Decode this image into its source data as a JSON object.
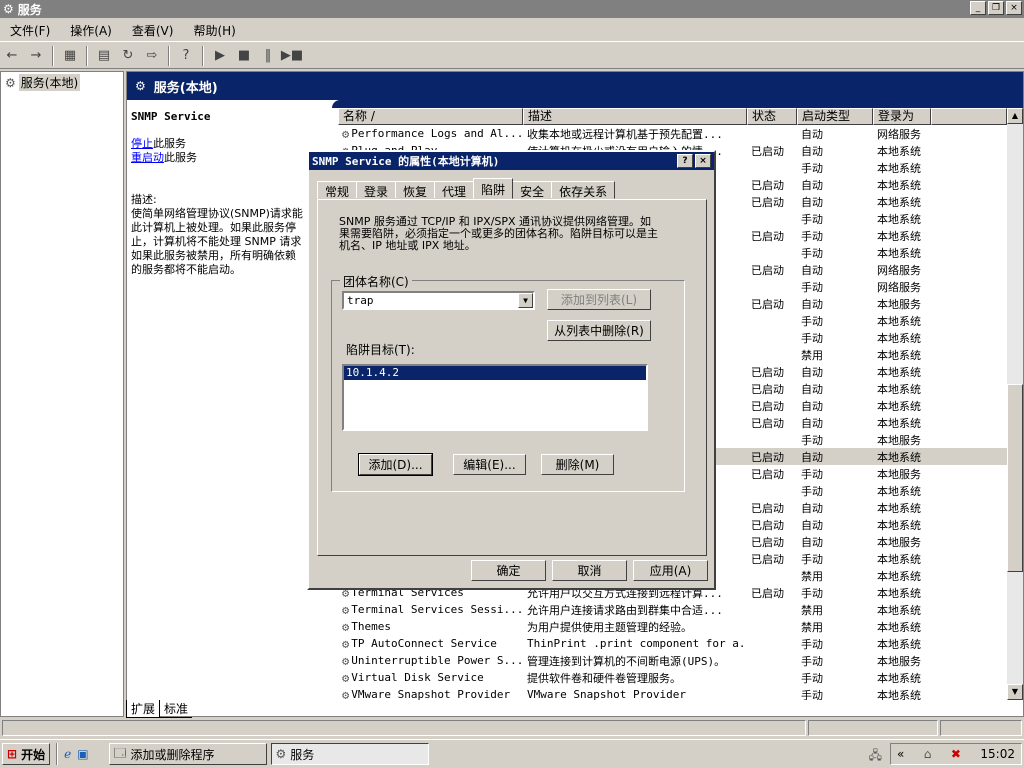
{
  "window": {
    "title": "服务",
    "min": "_",
    "restore": "❐",
    "close": "×"
  },
  "menu": [
    "文件(F)",
    "操作(A)",
    "查看(V)",
    "帮助(H)"
  ],
  "toolbar": [
    "←",
    "→",
    "▦",
    "▤",
    "↻",
    "⇨",
    "?",
    "▶",
    "■",
    "‖",
    "▶■"
  ],
  "tree": {
    "root": "服务(本地)"
  },
  "pane_header": "服务(本地)",
  "desc": {
    "name": "SNMP Service",
    "stop_link": "停止",
    "stop_suffix": "此服务",
    "restart_link": "重启动",
    "restart_suffix": "此服务",
    "label": "描述:",
    "lines": [
      "使简单网络管理协议(SNMP)请求能",
      "此计算机上被处理。如果此服务停",
      "止，计算机将不能处理 SNMP 请求",
      "如果此服务被禁用，所有明确依赖",
      "的服务都将不能启动。"
    ]
  },
  "list": {
    "headers": [
      "名称 /",
      "描述",
      "状态",
      "启动类型",
      "登录为"
    ],
    "rows": [
      [
        "Performance Logs and Al...",
        "收集本地或远程计算机基于预先配置...",
        "",
        "自动",
        "网络服务"
      ],
      [
        "Plug and Play",
        "使计算机在极少或没有用户输入的情...",
        "已启动",
        "自动",
        "本地系统"
      ],
      [
        "",
        "",
        "",
        "手动",
        "本地系统"
      ],
      [
        "",
        "",
        "已启动",
        "自动",
        "本地系统"
      ],
      [
        "",
        "",
        "已启动",
        "自动",
        "本地系统"
      ],
      [
        "",
        "",
        "",
        "手动",
        "本地系统"
      ],
      [
        "",
        "",
        "已启动",
        "手动",
        "本地系统"
      ],
      [
        "",
        "",
        "",
        "手动",
        "本地系统"
      ],
      [
        "",
        "",
        "已启动",
        "自动",
        "网络服务"
      ],
      [
        "",
        "",
        "",
        "手动",
        "网络服务"
      ],
      [
        "",
        "",
        "已启动",
        "自动",
        "本地服务"
      ],
      [
        "",
        "",
        "",
        "手动",
        "本地系统"
      ],
      [
        "",
        "",
        "",
        "手动",
        "本地系统"
      ],
      [
        "",
        "",
        "",
        "禁用",
        "本地系统"
      ],
      [
        "",
        "",
        "已启动",
        "自动",
        "本地系统"
      ],
      [
        "",
        "",
        "已启动",
        "自动",
        "本地系统"
      ],
      [
        "",
        "",
        "已启动",
        "自动",
        "本地系统"
      ],
      [
        "",
        "",
        "已启动",
        "自动",
        "本地系统"
      ],
      [
        "",
        "",
        "",
        "手动",
        "本地服务"
      ],
      [
        "",
        "",
        "已启动",
        "自动",
        "本地系统"
      ],
      [
        "",
        "",
        "已启动",
        "手动",
        "本地服务"
      ],
      [
        "",
        "",
        "",
        "手动",
        "本地系统"
      ],
      [
        "",
        "",
        "已启动",
        "自动",
        "本地系统"
      ],
      [
        "",
        "",
        "已启动",
        "自动",
        "本地系统"
      ],
      [
        "",
        "",
        "已启动",
        "自动",
        "本地服务"
      ],
      [
        "",
        "",
        "已启动",
        "手动",
        "本地系统"
      ],
      [
        "",
        "",
        "",
        "禁用",
        "本地系统"
      ],
      [
        "Terminal Services",
        "允许用户以交互方式连接到远程计算...",
        "已启动",
        "手动",
        "本地系统"
      ],
      [
        "Terminal Services Sessi...",
        "允许用户连接请求路由到群集中合适...",
        "",
        "禁用",
        "本地系统"
      ],
      [
        "Themes",
        "为用户提供使用主题管理的经验。",
        "",
        "禁用",
        "本地系统"
      ],
      [
        "TP AutoConnect Service",
        "ThinPrint .print component for a...",
        "",
        "手动",
        "本地系统"
      ],
      [
        "Uninterruptible Power S...",
        "管理连接到计算机的不间断电源(UPS)。",
        "",
        "手动",
        "本地服务"
      ],
      [
        "Virtual Disk Service",
        "提供软件卷和硬件卷管理服务。",
        "",
        "手动",
        "本地系统"
      ],
      [
        "VMware Snapshot Provider",
        "VMware Snapshot Provider",
        "",
        "手动",
        "本地系统"
      ]
    ],
    "selected_index": 19
  },
  "bottom_tabs": [
    "扩展",
    "标准"
  ],
  "dialog": {
    "title": "SNMP Service 的属性(本地计算机)",
    "help": "?",
    "close": "×",
    "tabs": [
      "常规",
      "登录",
      "恢复",
      "代理",
      "陷阱",
      "安全",
      "依存关系"
    ],
    "active_tab": "陷阱",
    "intro": "SNMP 服务通过 TCP/IP 和 IPX/SPX 通讯协议提供网络管理。如果需要陷阱，必须指定一个或更多的团体名称。陷阱目标可以是主机名、IP 地址或 IPX 地址。",
    "group_label": "团体名称(C)",
    "community_value": "trap",
    "add_to_list": "添加到列表(L)",
    "remove_from_list": "从列表中删除(R)",
    "targets_label": "陷阱目标(T):",
    "targets": [
      "10.1.4.2"
    ],
    "add": "添加(D)...",
    "edit": "编辑(E)...",
    "remove": "删除(M)",
    "ok": "确定",
    "cancel": "取消",
    "apply": "应用(A)"
  },
  "taskbar": {
    "start": "开始",
    "tasks": [
      "添加或删除程序",
      "服务"
    ],
    "clock": "15:02",
    "tray_chevron": "«"
  }
}
